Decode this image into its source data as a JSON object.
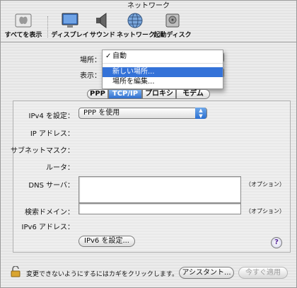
{
  "window": {
    "title": "ネットワーク"
  },
  "toolbar": {
    "items": [
      {
        "label": "すべてを表示",
        "icon": "show-all-icon"
      },
      {
        "label": "ディスプレイ",
        "icon": "display-icon"
      },
      {
        "label": "サウンド",
        "icon": "speaker-icon"
      },
      {
        "label": "ネットワーク",
        "icon": "network-globe-icon"
      },
      {
        "label": "起動ディスク",
        "icon": "startup-disk-icon"
      }
    ]
  },
  "location": {
    "label": "場所：",
    "show_label": "表示："
  },
  "location_menu": {
    "items": [
      {
        "label": "自動",
        "checked": true
      },
      {
        "label": "新しい場所...",
        "highlighted": true
      },
      {
        "label": "場所を編集..."
      }
    ]
  },
  "tabs": [
    {
      "label": "PPP"
    },
    {
      "label": "TCP/IP",
      "active": true
    },
    {
      "label": "プロキシ"
    },
    {
      "label": "モデム"
    }
  ],
  "tcpip": {
    "ipv4_label": "IPv4 を設定：",
    "ipv4_value": "PPP を使用",
    "ip_label": "IP アドレス：",
    "subnet_label": "サブネットマスク：",
    "router_label": "ルータ：",
    "dns_label": "DNS サーバ：",
    "dns_option": "（オプション）",
    "search_label": "検索ドメイン：",
    "search_option": "（オプション）",
    "ipv6_label": "IPv6 アドレス：",
    "ipv6_button": "IPv6 を設定..."
  },
  "help": {
    "label": "?"
  },
  "footer": {
    "lock_text": "変更できないようにするにはカギをクリックします。",
    "assist_button": "アシスタント...",
    "apply_button": "今すぐ適用"
  }
}
